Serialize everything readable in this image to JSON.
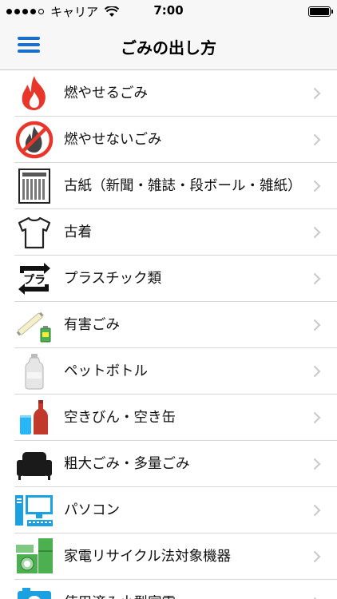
{
  "status_bar": {
    "carrier": "キャリア",
    "time": "7:00"
  },
  "nav": {
    "title": "ごみの出し方"
  },
  "items": [
    {
      "label": "燃やせるごみ",
      "icon": "flame-icon"
    },
    {
      "label": "燃やせないごみ",
      "icon": "no-burn-icon"
    },
    {
      "label": "古紙（新聞・雑誌・段ボール・雑紙）",
      "icon": "newspaper-icon"
    },
    {
      "label": "古着",
      "icon": "tshirt-icon"
    },
    {
      "label": "プラスチック類",
      "icon": "plastic-recycle-icon"
    },
    {
      "label": "有害ごみ",
      "icon": "hazardous-icon"
    },
    {
      "label": "ペットボトル",
      "icon": "pet-bottle-icon"
    },
    {
      "label": "空きびん・空き缶",
      "icon": "bottle-can-icon"
    },
    {
      "label": "粗大ごみ・多量ごみ",
      "icon": "sofa-icon"
    },
    {
      "label": "パソコン",
      "icon": "computer-icon"
    },
    {
      "label": "家電リサイクル法対象機器",
      "icon": "appliance-icon"
    },
    {
      "label": "使用済み小型家電",
      "icon": "camera-icon"
    }
  ],
  "colors": {
    "accent": "#1a6fc9",
    "flame": "#e8362b",
    "separator": "#d8d8d8",
    "chevron": "#c7c7cc"
  }
}
